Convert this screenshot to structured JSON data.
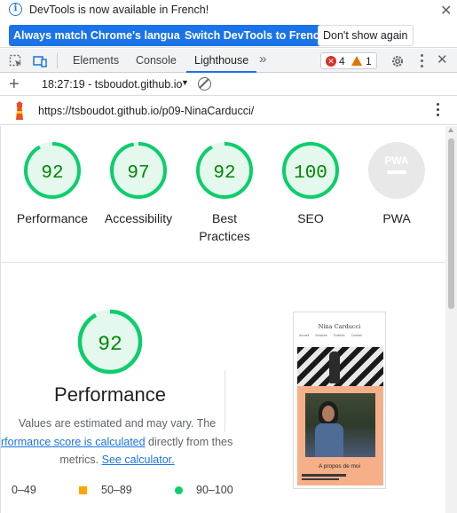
{
  "infobar": {
    "message": "DevTools is now available in French!",
    "btn_match": "Always match Chrome's language",
    "btn_switch": "Switch DevTools to French",
    "btn_dismiss": "Don't show again"
  },
  "tabs": [
    {
      "label": "Elements"
    },
    {
      "label": "Console"
    },
    {
      "label": "Lighthouse"
    }
  ],
  "counters": {
    "errors": "4",
    "warnings": "1"
  },
  "report": {
    "selector": "18:27:19 - tsboudot.github.io"
  },
  "url": "https://tsboudot.github.io/p09-NinaCarducci/",
  "scores": [
    {
      "value": "92",
      "score": 0.92,
      "label": "Performance"
    },
    {
      "value": "97",
      "score": 0.97,
      "label": "Accessibility"
    },
    {
      "value": "92",
      "score": 0.92,
      "label": "Best Practices"
    },
    {
      "value": "100",
      "score": 1.0,
      "label": "SEO"
    },
    {
      "value": "",
      "score": 0,
      "label": "PWA"
    }
  ],
  "pwa_badge": "PWA",
  "performance": {
    "value": "92",
    "score": 0.92,
    "title": "Performance",
    "desc_line1": "Values are estimated and may vary. The",
    "desc_link": "rformance score is calculated",
    "desc_after_link": " directly from these",
    "desc_line3_pre": "metrics. ",
    "desc_line3_link": "See calculator."
  },
  "legend": {
    "fail": "0–49",
    "average": "50–89",
    "pass": "90–100"
  },
  "thumbnail": {
    "site_title": "Nina Carducci",
    "nav": [
      "Accueil",
      "Services",
      "Portfolio",
      "Contact"
    ],
    "caption": "A propos de moi"
  },
  "colors": {
    "pass": "#0cce6b",
    "pass_text": "#008800",
    "pass_bg": "#e5f8ee",
    "average": "#ffa400",
    "fail": "#ff4e42",
    "accent": "#1a73e8"
  }
}
